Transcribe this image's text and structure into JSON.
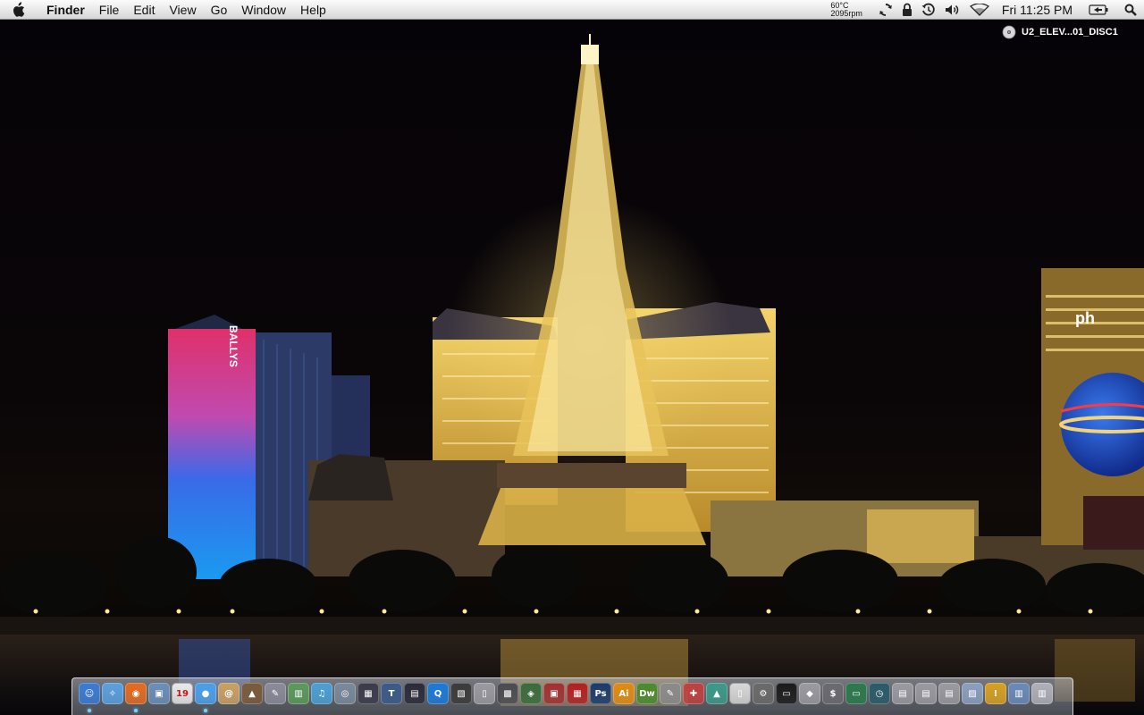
{
  "menubar": {
    "app_name": "Finder",
    "menus": [
      "File",
      "Edit",
      "View",
      "Go",
      "Window",
      "Help"
    ],
    "temperature": "60°C",
    "fan_speed": "2095rpm",
    "clock": "Fri 11:25 PM",
    "status_icons": [
      "sync-icon",
      "lock-icon",
      "time-machine-icon",
      "volume-icon",
      "wifi-icon",
      "battery-icon",
      "spotlight-icon"
    ]
  },
  "desktop": {
    "disc_label": "U2_ELEV...01_DISC1",
    "wallpaper_sign_ballys": "BALLYS",
    "wallpaper_sign_ph": "ph"
  },
  "dock": {
    "items": [
      {
        "name": "finder",
        "glyph": "☺",
        "color": "#3a7bd5",
        "running": true
      },
      {
        "name": "safari",
        "glyph": "✧",
        "color": "#5aa0e0",
        "running": false
      },
      {
        "name": "firefox",
        "glyph": "◉",
        "color": "#e56b1f",
        "running": true
      },
      {
        "name": "preview",
        "glyph": "▣",
        "color": "#6a8fb8",
        "running": false
      },
      {
        "name": "ical",
        "glyph": "19",
        "color": "#e9e9e9",
        "running": false
      },
      {
        "name": "ichat",
        "glyph": "●",
        "color": "#4a9fe8",
        "running": true
      },
      {
        "name": "address-book",
        "glyph": "@",
        "color": "#c9a060",
        "running": false
      },
      {
        "name": "keynote",
        "glyph": "▲",
        "color": "#7a5a3a",
        "running": false
      },
      {
        "name": "script-editor",
        "glyph": "✎",
        "color": "#8a8a9a",
        "running": false
      },
      {
        "name": "activity-monitor",
        "glyph": "▥",
        "color": "#5a9a5a",
        "running": false
      },
      {
        "name": "itunes",
        "glyph": "♫",
        "color": "#4aa0d8",
        "running": false
      },
      {
        "name": "dvd-player",
        "glyph": "◎",
        "color": "#7a8a9a",
        "running": false
      },
      {
        "name": "imovie",
        "glyph": "▦",
        "color": "#3a3a4a",
        "running": false
      },
      {
        "name": "textedit",
        "glyph": "T",
        "color": "#3a5a8a",
        "running": false
      },
      {
        "name": "final-cut",
        "glyph": "▤",
        "color": "#2a2a3a",
        "running": false
      },
      {
        "name": "quicktime",
        "glyph": "Q",
        "color": "#1a7ad8",
        "running": false
      },
      {
        "name": "clapper",
        "glyph": "▧",
        "color": "#3a3a3a",
        "running": false
      },
      {
        "name": "ipod-utility",
        "glyph": "▯",
        "color": "#9a9aa0",
        "running": false
      },
      {
        "name": "film-strip",
        "glyph": "▩",
        "color": "#4a4a50",
        "running": false
      },
      {
        "name": "iphoto",
        "glyph": "◈",
        "color": "#3a6a3a",
        "running": false
      },
      {
        "name": "photo-booth",
        "glyph": "▣",
        "color": "#a03030",
        "running": false
      },
      {
        "name": "front-row",
        "glyph": "▦",
        "color": "#b02020",
        "running": false
      },
      {
        "name": "photoshop",
        "glyph": "Ps",
        "color": "#1a3a6a",
        "running": false
      },
      {
        "name": "illustrator",
        "glyph": "Ai",
        "color": "#e08a10",
        "running": false
      },
      {
        "name": "dreamweaver",
        "glyph": "Dw",
        "color": "#4a8a2a",
        "running": false
      },
      {
        "name": "image-capture",
        "glyph": "✎",
        "color": "#8a8a8a",
        "running": false
      },
      {
        "name": "syncrify",
        "glyph": "✚",
        "color": "#c04040",
        "running": false
      },
      {
        "name": "automator",
        "glyph": "▲",
        "color": "#3a9a8a",
        "running": false
      },
      {
        "name": "textwrangler",
        "glyph": "▯",
        "color": "#d8d8d8",
        "running": false
      },
      {
        "name": "system-preferences",
        "glyph": "⚙",
        "color": "#6a6a6a",
        "running": false
      },
      {
        "name": "terminal",
        "glyph": "▭",
        "color": "#1a1a1a",
        "running": false
      },
      {
        "name": "installer",
        "glyph": "◆",
        "color": "#9a9aa0",
        "running": false
      },
      {
        "name": "console",
        "glyph": "$",
        "color": "#6a6a70",
        "running": false
      },
      {
        "name": "screen-sharing",
        "glyph": "▭",
        "color": "#2a7a4a",
        "running": false
      },
      {
        "name": "time-machine",
        "glyph": "◷",
        "color": "#2a5a6a",
        "running": false
      },
      {
        "name": "drive-1",
        "glyph": "▤",
        "color": "#9a9aa0",
        "running": false
      },
      {
        "name": "drive-2",
        "glyph": "▤",
        "color": "#9a9aa0",
        "running": false
      },
      {
        "name": "drive-3",
        "glyph": "▤",
        "color": "#9a9aa0",
        "running": false
      },
      {
        "name": "pictures-folder",
        "glyph": "▨",
        "color": "#8aa0c0",
        "running": false
      },
      {
        "name": "warning-folder",
        "glyph": "!",
        "color": "#d8a020",
        "running": false
      },
      {
        "name": "documents-folder",
        "glyph": "▥",
        "color": "#6a8ab8",
        "running": false
      },
      {
        "name": "trash",
        "glyph": "▥",
        "color": "#b0b0b8",
        "running": false
      }
    ]
  }
}
